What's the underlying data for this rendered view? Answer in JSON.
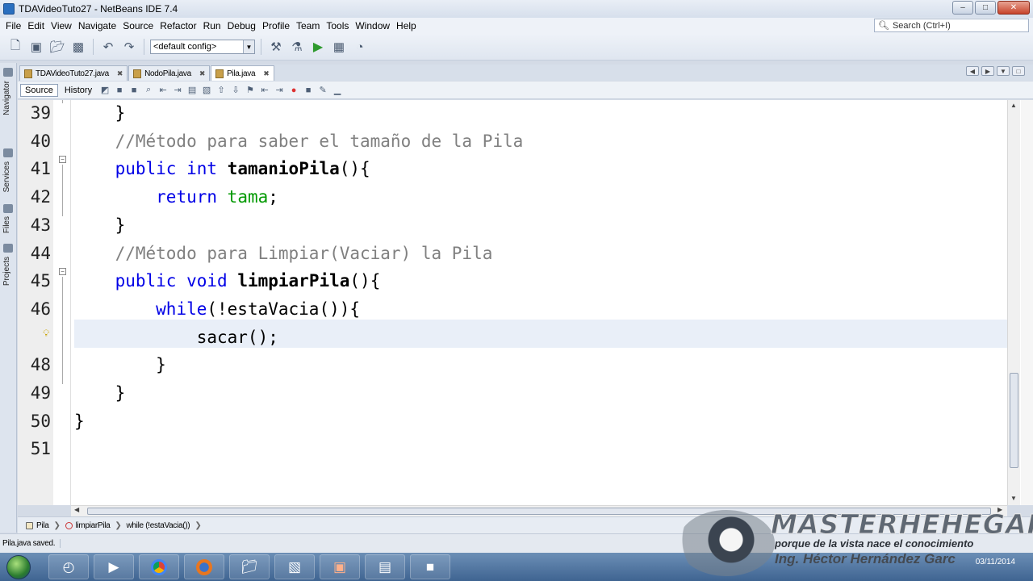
{
  "window": {
    "title": "TDAVideoTuto27 - NetBeans IDE 7.4",
    "controls": [
      "–",
      "□",
      "✕"
    ]
  },
  "menu": [
    "File",
    "Edit",
    "View",
    "Navigate",
    "Source",
    "Refactor",
    "Run",
    "Debug",
    "Profile",
    "Team",
    "Tools",
    "Window",
    "Help"
  ],
  "search": {
    "placeholder": "Search (Ctrl+I)"
  },
  "toolbar": {
    "config": "<default config>"
  },
  "side_panels": [
    "Navigator",
    "Services",
    "Files",
    "Projects"
  ],
  "tabs": [
    {
      "label": "TDAVideoTuto27.java",
      "active": false
    },
    {
      "label": "NodoPila.java",
      "active": false
    },
    {
      "label": "Pila.java",
      "active": true
    }
  ],
  "editor_toolbar": {
    "source": "Source",
    "history": "History"
  },
  "code": {
    "lines": [
      {
        "num": "39",
        "tokens": [
          {
            "t": "    }",
            "c": ""
          }
        ]
      },
      {
        "num": "40",
        "tokens": [
          {
            "t": "    //Método para saber el tamaño de la Pila",
            "c": "cm"
          }
        ]
      },
      {
        "num": "41",
        "tokens": [
          {
            "t": "    ",
            "c": ""
          },
          {
            "t": "public",
            "c": "kw"
          },
          {
            "t": " ",
            "c": ""
          },
          {
            "t": "int",
            "c": "kw"
          },
          {
            "t": " ",
            "c": ""
          },
          {
            "t": "tamanioPila",
            "c": "mth"
          },
          {
            "t": "(){",
            "c": ""
          }
        ]
      },
      {
        "num": "42",
        "tokens": [
          {
            "t": "        ",
            "c": ""
          },
          {
            "t": "return",
            "c": "kw"
          },
          {
            "t": " ",
            "c": ""
          },
          {
            "t": "tama",
            "c": "fld"
          },
          {
            "t": ";",
            "c": ""
          }
        ]
      },
      {
        "num": "43",
        "tokens": [
          {
            "t": "    }",
            "c": ""
          }
        ]
      },
      {
        "num": "44",
        "tokens": [
          {
            "t": "    //Método para Limpiar(Vaciar) la Pila",
            "c": "cm"
          }
        ]
      },
      {
        "num": "45",
        "tokens": [
          {
            "t": "    ",
            "c": ""
          },
          {
            "t": "public",
            "c": "kw"
          },
          {
            "t": " ",
            "c": ""
          },
          {
            "t": "void",
            "c": "kw"
          },
          {
            "t": " ",
            "c": ""
          },
          {
            "t": "limpiarPila",
            "c": "mth"
          },
          {
            "t": "(){",
            "c": ""
          }
        ]
      },
      {
        "num": "46",
        "tokens": [
          {
            "t": "        ",
            "c": ""
          },
          {
            "t": "while",
            "c": "kw"
          },
          {
            "t": "(!estaVacia()){",
            "c": ""
          }
        ]
      },
      {
        "num": "",
        "tokens": [
          {
            "t": "            sacar();",
            "c": ""
          }
        ]
      },
      {
        "num": "48",
        "tokens": [
          {
            "t": "        }",
            "c": ""
          }
        ]
      },
      {
        "num": "49",
        "tokens": [
          {
            "t": "    }",
            "c": ""
          }
        ]
      },
      {
        "num": "50",
        "tokens": [
          {
            "t": "}",
            "c": ""
          }
        ]
      },
      {
        "num": "51",
        "tokens": [
          {
            "t": "",
            "c": ""
          }
        ]
      }
    ]
  },
  "breadcrumb": [
    "Pila",
    "limpiarPila",
    "while (!estaVacia())"
  ],
  "status": {
    "message": "Pila.java saved."
  },
  "taskbar": {
    "date": "03/11/2014"
  },
  "watermark": {
    "brand": "MASTERHEHEGAR",
    "slogan": "porque de la vista nace el conocimiento",
    "author": "Ing. Héctor Hernández Garc"
  },
  "colors": {
    "keyword": "#0000e6",
    "comment": "#808080",
    "field": "#009900",
    "current_line": "#e9eff8"
  }
}
